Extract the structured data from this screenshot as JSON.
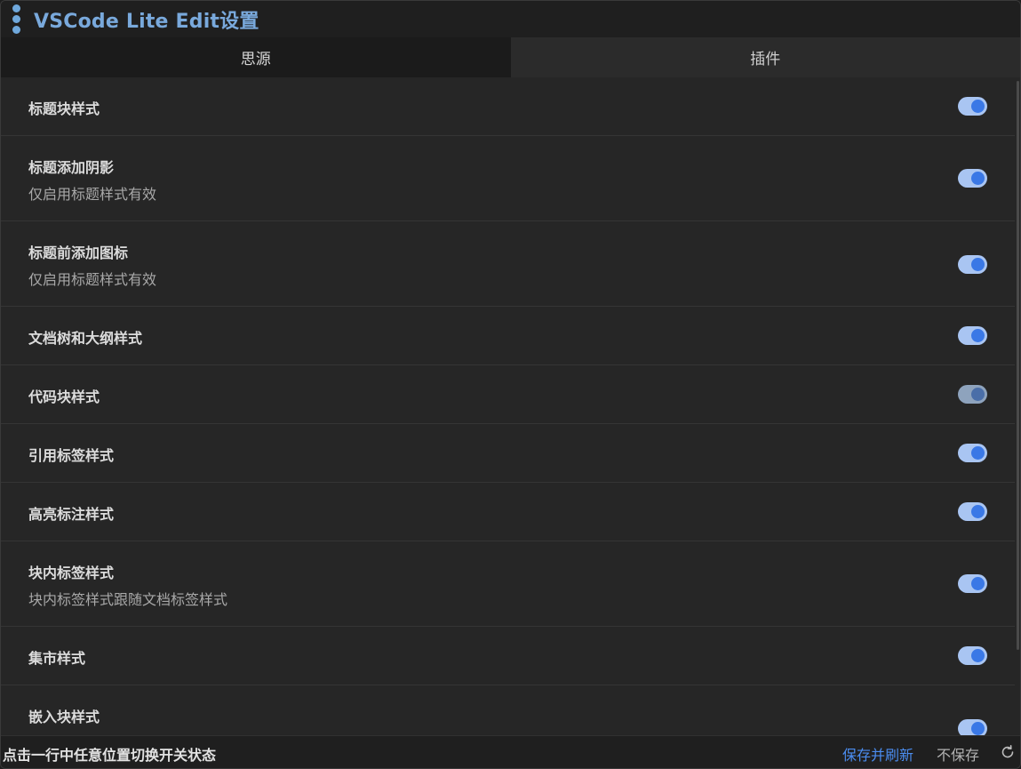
{
  "title": "VSCode Lite Edit设置",
  "tabs": [
    {
      "label": "思源"
    },
    {
      "label": "插件"
    }
  ],
  "rows": [
    {
      "label": "标题块样式",
      "desc": "",
      "on": true
    },
    {
      "label": "标题添加阴影",
      "desc": "仅启用标题样式有效",
      "on": true
    },
    {
      "label": "标题前添加图标",
      "desc": "仅启用标题样式有效",
      "on": true
    },
    {
      "label": "文档树和大纲样式",
      "desc": "",
      "on": true
    },
    {
      "label": "代码块样式",
      "desc": "",
      "on": true
    },
    {
      "label": "引用标签样式",
      "desc": "",
      "on": true
    },
    {
      "label": "高亮标注样式",
      "desc": "",
      "on": true
    },
    {
      "label": "块内标签样式",
      "desc": "块内标签样式跟随文档标签样式",
      "on": true
    },
    {
      "label": "集市样式",
      "desc": "",
      "on": true
    },
    {
      "label": "嵌入块样式",
      "desc": "",
      "on": true
    }
  ],
  "footer": {
    "hint": "点击一行中任意位置切换开关状态",
    "save_label": "保存并刷新",
    "nosave_label": "不保存",
    "refresh_icon": "refresh-icon"
  },
  "colors": {
    "accent": "#3a78e6",
    "title": "#79a9dc",
    "save": "#4b8df0"
  }
}
